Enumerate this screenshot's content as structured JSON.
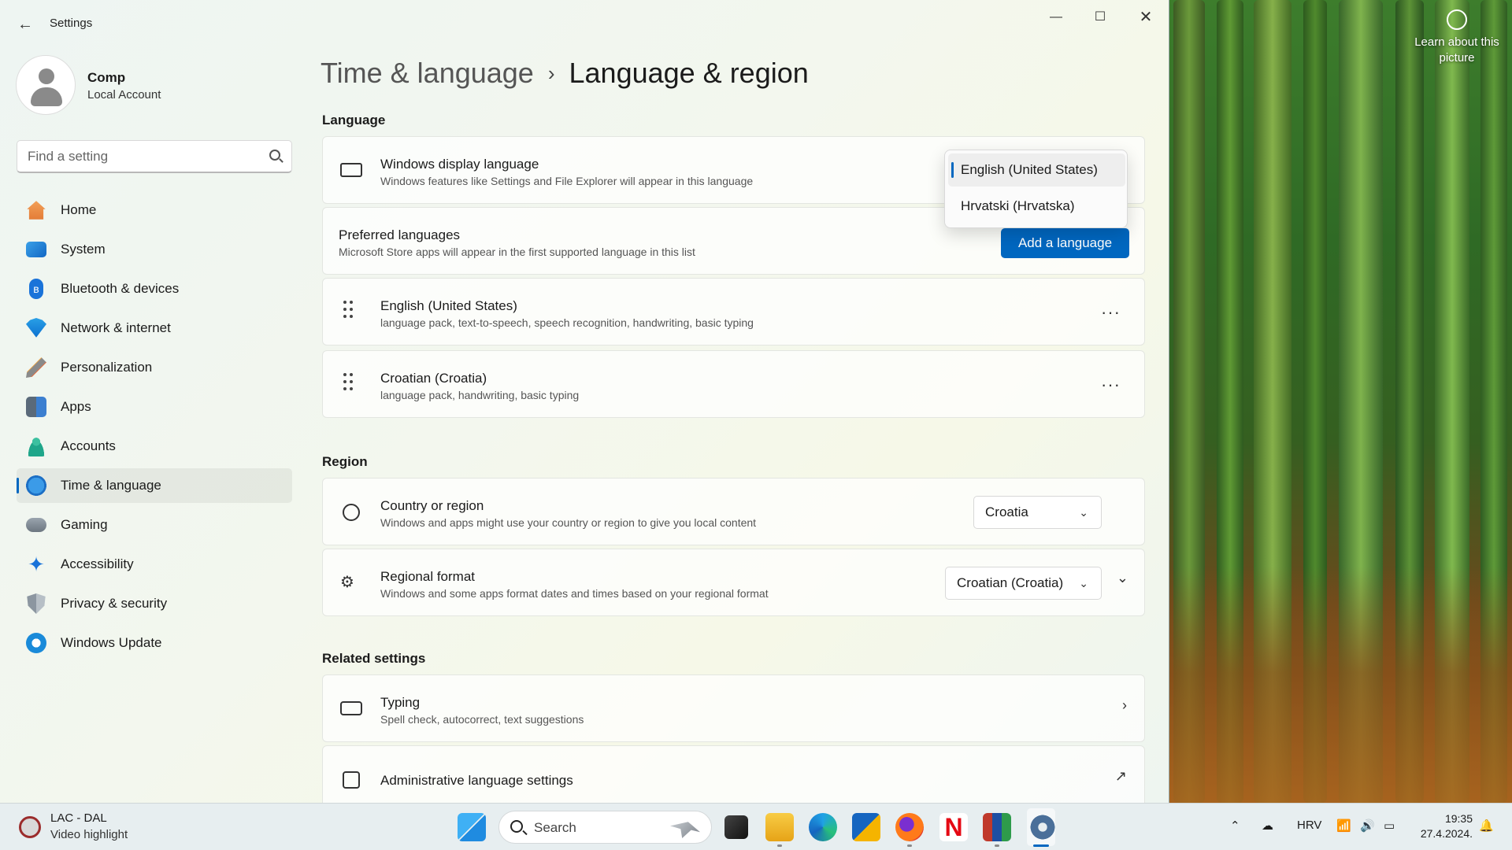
{
  "app": {
    "title": "Settings"
  },
  "profile": {
    "name": "Comp",
    "account_type": "Local Account"
  },
  "search": {
    "placeholder": "Find a setting"
  },
  "nav": [
    {
      "label": "Home",
      "icon": "home-icon"
    },
    {
      "label": "System",
      "icon": "system-icon"
    },
    {
      "label": "Bluetooth & devices",
      "icon": "bluetooth-icon"
    },
    {
      "label": "Network & internet",
      "icon": "wifi-icon"
    },
    {
      "label": "Personalization",
      "icon": "brush-icon"
    },
    {
      "label": "Apps",
      "icon": "apps-icon"
    },
    {
      "label": "Accounts",
      "icon": "person-icon"
    },
    {
      "label": "Time & language",
      "icon": "globe-clock-icon",
      "active": true
    },
    {
      "label": "Gaming",
      "icon": "gamepad-icon"
    },
    {
      "label": "Accessibility",
      "icon": "accessibility-icon"
    },
    {
      "label": "Privacy & security",
      "icon": "shield-icon"
    },
    {
      "label": "Windows Update",
      "icon": "update-icon"
    }
  ],
  "breadcrumb": {
    "parent": "Time & language",
    "separator": "›",
    "current": "Language & region"
  },
  "language": {
    "header": "Language",
    "display": {
      "title": "Windows display language",
      "desc": "Windows features like Settings and File Explorer will appear in this language"
    },
    "display_options": [
      "English (United States)",
      "Hrvatski (Hrvatska)"
    ],
    "display_selected": "English (United States)",
    "preferred": {
      "title": "Preferred languages",
      "desc": "Microsoft Store apps will appear in the first supported language in this list",
      "add_button": "Add a language"
    },
    "items": [
      {
        "name": "English (United States)",
        "features": "language pack, text-to-speech, speech recognition, handwriting, basic typing"
      },
      {
        "name": "Croatian (Croatia)",
        "features": "language pack, handwriting, basic typing"
      }
    ],
    "more_label": "···"
  },
  "region": {
    "header": "Region",
    "country": {
      "title": "Country or region",
      "desc": "Windows and apps might use your country or region to give you local content",
      "value": "Croatia"
    },
    "format": {
      "title": "Regional format",
      "desc": "Windows and some apps format dates and times based on your regional format",
      "value": "Croatian (Croatia)"
    }
  },
  "related": {
    "header": "Related settings",
    "typing": {
      "title": "Typing",
      "desc": "Spell check, autocorrect, text suggestions"
    },
    "admin": {
      "title": "Administrative language settings"
    }
  },
  "desktop": {
    "learn": "Learn about this picture"
  },
  "taskbar": {
    "widget_title": "LAC - DAL",
    "widget_sub": "Video highlight",
    "search_label": "Search",
    "lang": "HRV",
    "time": "19:35",
    "date": "27.4.2024."
  },
  "colors": {
    "accent": "#0067c0"
  }
}
